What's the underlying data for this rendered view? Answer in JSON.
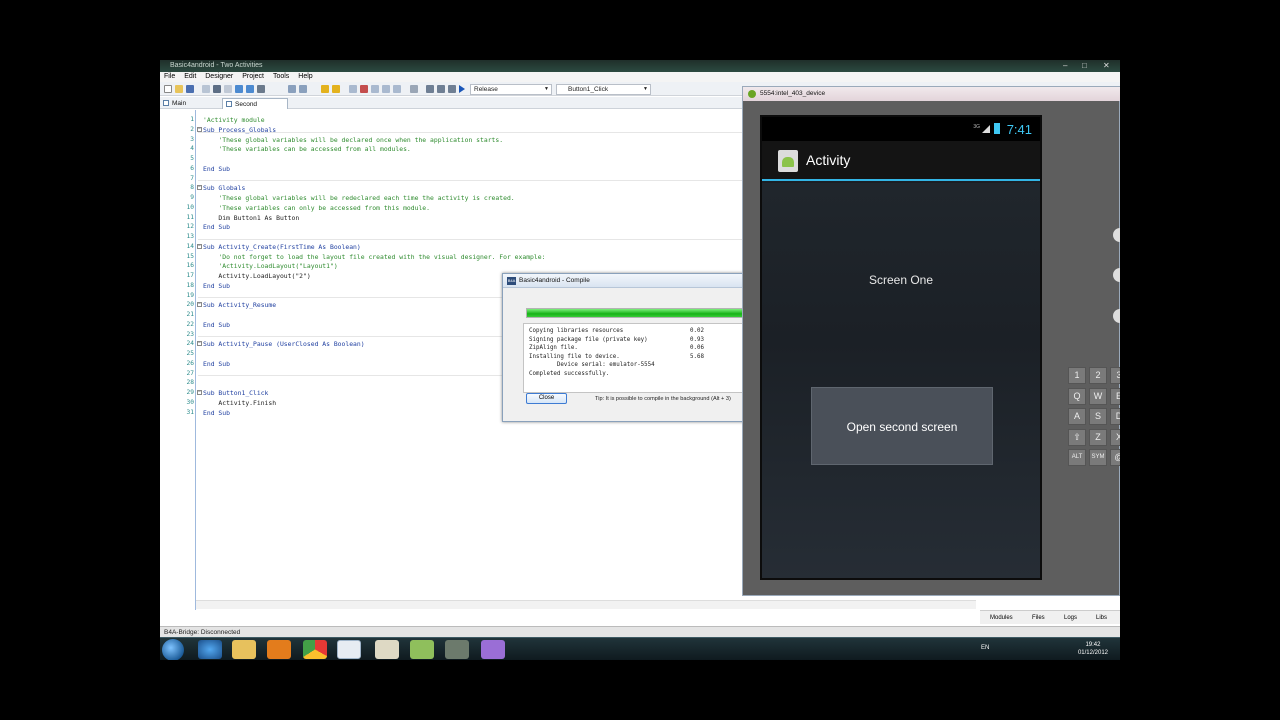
{
  "ide": {
    "title": "Basic4android - Two Activities",
    "window_controls": [
      "–",
      "□",
      "✕"
    ],
    "menu": [
      "File",
      "Edit",
      "Designer",
      "Project",
      "Tools",
      "Help"
    ],
    "build_config": "Release",
    "sub_selector": "Button1_Click",
    "tabs": [
      {
        "label": "Main"
      },
      {
        "label": "Second"
      }
    ],
    "code_lines": [
      "'Activity module",
      "Sub Process_Globals",
      "    'These global variables will be declared once when the application starts.",
      "    'These variables can be accessed from all modules.",
      "",
      "End Sub",
      "",
      "Sub Globals",
      "    'These global variables will be redeclared each time the activity is created.",
      "    'These variables can only be accessed from this module.",
      "    Dim Button1 As Button",
      "End Sub",
      "",
      "Sub Activity_Create(FirstTime As Boolean)",
      "    'Do not forget to load the layout file created with the visual designer. For example:",
      "    'Activity.LoadLayout(\"Layout1\")",
      "    Activity.LoadLayout(\"2\")",
      "End Sub",
      "",
      "Sub Activity_Resume",
      "",
      "End Sub",
      "",
      "Sub Activity_Pause (UserClosed As Boolean)",
      "",
      "End Sub",
      "",
      "",
      "Sub Button1_Click",
      "    Activity.Finish",
      "End Sub"
    ],
    "line_numbers": [
      "1",
      "2",
      "3",
      "4",
      "5",
      "6",
      "7",
      "8",
      "9",
      "10",
      "11",
      "12",
      "13",
      "14",
      "15",
      "16",
      "17",
      "18",
      "19",
      "20",
      "21",
      "22",
      "23",
      "24",
      "25",
      "26",
      "27",
      "28",
      "29",
      "30",
      "31"
    ],
    "status": "B4A-Bridge: Disconnected",
    "right_tabs": [
      "Modules",
      "Files",
      "Logs",
      "Libs"
    ]
  },
  "compile_dialog": {
    "title": "Basic4android - Compile",
    "icon_text": "B4A",
    "progress": 1.0,
    "log_lines": [
      {
        "text": "Copying libraries resources",
        "value": "0.02"
      },
      {
        "text": "Signing package file (private key)",
        "value": "0.93"
      },
      {
        "text": "ZipAlign file.",
        "value": "0.06"
      },
      {
        "text": "Installing file to device.",
        "value": "5.68"
      },
      {
        "text": "        Device serial: emulator-5554",
        "value": ""
      },
      {
        "text": "Completed successfully.",
        "value": ""
      }
    ],
    "close_label": "Close",
    "tip": "Tip: It is possible to compile in the background (Alt + 3)"
  },
  "emulator": {
    "title": "5554:intel_403_device",
    "network": "3G",
    "time": "7:41",
    "app_title": "Activity",
    "screen_label": "Screen One",
    "button_label": "Open second screen",
    "keyboard_keys": [
      "1",
      "2",
      "3",
      "Q",
      "W",
      "E",
      "A",
      "S",
      "D",
      "⇧",
      "Z",
      "X",
      "ALT",
      "SYM",
      "@"
    ]
  },
  "taskbar": {
    "language": "EN",
    "time": "19:42",
    "date": "01/12/2012"
  },
  "colors": {
    "accent_holo": "#33b5e5",
    "progress_green": "#18b218",
    "code_keyword": "#1f3fa0",
    "code_comment": "#2e8b2e"
  }
}
